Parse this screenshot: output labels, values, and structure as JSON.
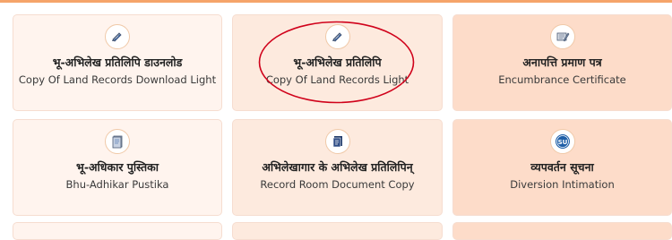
{
  "services": [
    {
      "title": "भू-अभिलेख प्रतिलिपि डाउनलोड",
      "subtitle": "Copy Of Land Records Download Light",
      "icon": "pencil-icon"
    },
    {
      "title": "भू-अभिलेख प्रतिलिपि",
      "subtitle": "Copy Of Land Records Light",
      "icon": "pencil-icon"
    },
    {
      "title": "अनापत्ति प्रमाण पत्र",
      "subtitle": "Encumbrance Certificate",
      "icon": "certificate-icon"
    },
    {
      "title": "भू-अधिकार पुस्तिका",
      "subtitle": "Bhu-Adhikar Pustika",
      "icon": "booklet-icon"
    },
    {
      "title": "अभिलेखागार के अभिलेख प्रतिलिपिन्",
      "subtitle": "Record Room Document Copy",
      "icon": "document-icon"
    },
    {
      "title": "व्यपवर्तन सूचना",
      "subtitle": "Diversion Intimation",
      "icon": "su-badge-icon"
    }
  ],
  "annotation": {
    "highlight_color": "#d0021b"
  },
  "colors": {
    "accent_strip": "#f5a46a",
    "icon_blue": "#2c5aa0"
  }
}
